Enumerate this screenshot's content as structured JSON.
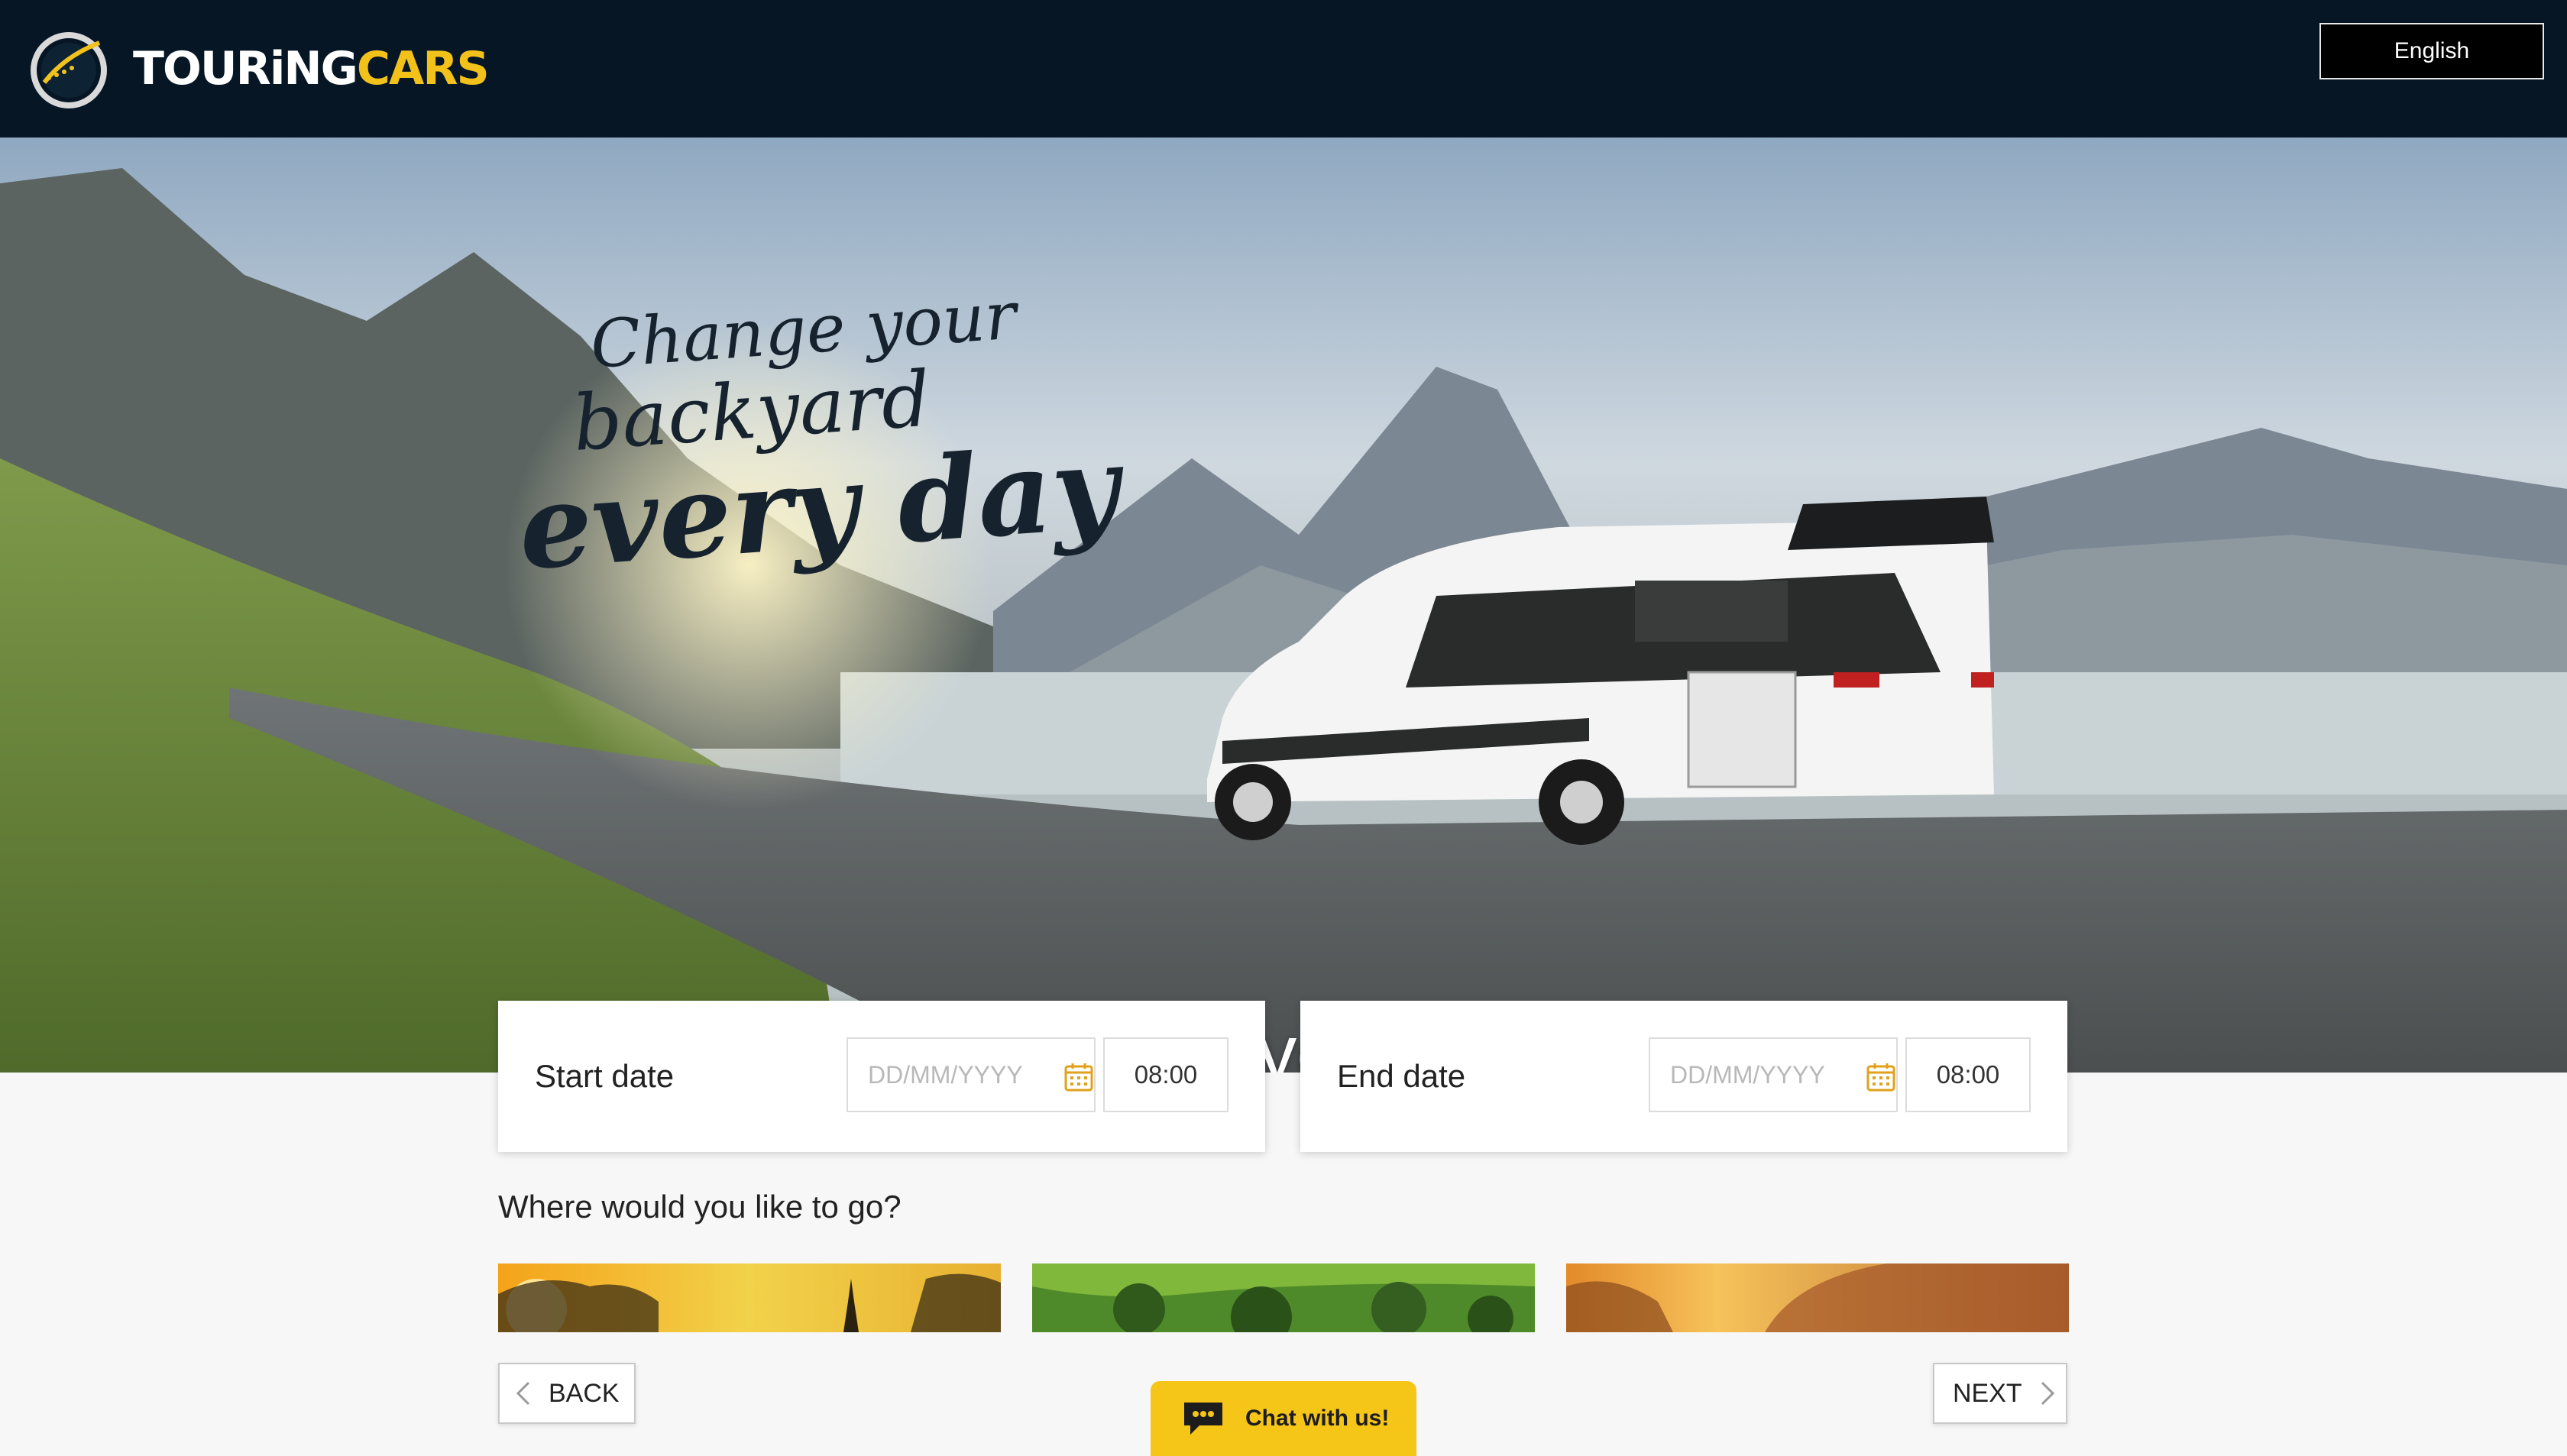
{
  "header": {
    "logo_text_part1": "TOURiNG",
    "logo_text_part2": "CARS",
    "language_label": "English"
  },
  "hero": {
    "slogan_line1": "Change your",
    "slogan_line2": "backyard",
    "slogan_line3": "every day",
    "question": "When would you like to go?"
  },
  "start": {
    "label": "Start date",
    "date_placeholder": "DD/MM/YYYY",
    "time_value": "08:00"
  },
  "end": {
    "label": "End date",
    "date_placeholder": "DD/MM/YYYY",
    "time_value": "08:00"
  },
  "destinations": {
    "heading": "Where would you like to go?"
  },
  "nav": {
    "back_label": "BACK",
    "next_label": "NEXT"
  },
  "chat": {
    "label": "Chat with us!"
  },
  "colors": {
    "header_bg": "#061624",
    "brand_yellow": "#f2c21b",
    "chat_yellow": "#f5c518",
    "calendar_icon": "#e0a21a"
  },
  "icons": {
    "logo": "logo-ring-icon",
    "calendar": "calendar-icon",
    "back": "chevron-left-icon",
    "next": "chevron-right-icon",
    "chat": "chat-bubble-icon"
  }
}
